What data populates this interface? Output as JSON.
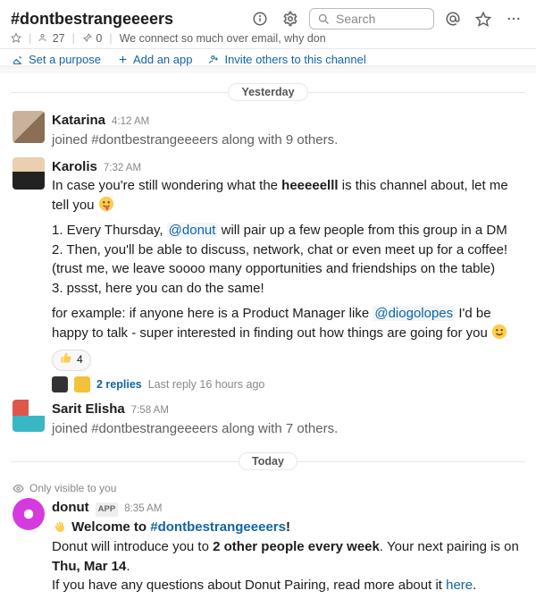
{
  "header": {
    "channel_name": "#dontbestrangeeeers",
    "members": "27",
    "pins": "0",
    "topic": "We connect so much over email, why don",
    "search_placeholder": "Search"
  },
  "actions": {
    "set_purpose": "Set a purpose",
    "add_app": "Add an app",
    "invite": "Invite others to this channel"
  },
  "dividers": {
    "yesterday": "Yesterday",
    "today": "Today"
  },
  "visibility_notice": "Only visible to you",
  "messages": {
    "m1": {
      "author": "Katarina",
      "time": "4:12 AM",
      "text_a": "joined ",
      "channel": "#dontbestrangeeeers",
      "text_b": " along with 9 others."
    },
    "m2": {
      "author": "Karolis",
      "time": "7:32 AM",
      "intro_a": "In case you're still wondering what the ",
      "intro_bold": "heeeeelll",
      "intro_b": " is this channel about, let me tell you ",
      "li1_a": "1. Every Thursday, ",
      "li1_mention": "@donut",
      "li1_b": " will pair up a few people from this group in a DM",
      "li2": "2. Then, you'll be able to discuss, network, chat or even meet up for a coffee! (trust me, we leave soooo many opportunities and friendships on the table)",
      "li3": "3. pssst, here you can do the same!",
      "ex_a": "for example: if anyone here is a Product Manager like ",
      "ex_mention": "@diogolopes",
      "ex_b": " I'd be happy to talk - super interested in finding out how things are going for you ",
      "reaction_count": "4",
      "replies": "2 replies",
      "last_reply": "Last reply 16 hours ago"
    },
    "m3": {
      "author": "Sarit Elisha",
      "time": "7:58 AM",
      "text_a": "joined ",
      "channel": "#dontbestrangeeeers",
      "text_b": " along with 7 others."
    },
    "m4": {
      "author": "donut",
      "badge": "APP",
      "time": "8:35 AM",
      "line1_a": "Welcome to ",
      "line1_chan": "#dontbestrangeeeers",
      "line1_b": "!",
      "line2_a": "Donut will introduce you to ",
      "line2_bold1": "2 other people every week",
      "line2_b": ". Your next pairing is on ",
      "line2_bold2": "Thu, Mar 14",
      "line2_c": ".",
      "line3_a": "If you have any questions about Donut Pairing, read more about it ",
      "line3_link": "here",
      "line3_b": "."
    }
  }
}
